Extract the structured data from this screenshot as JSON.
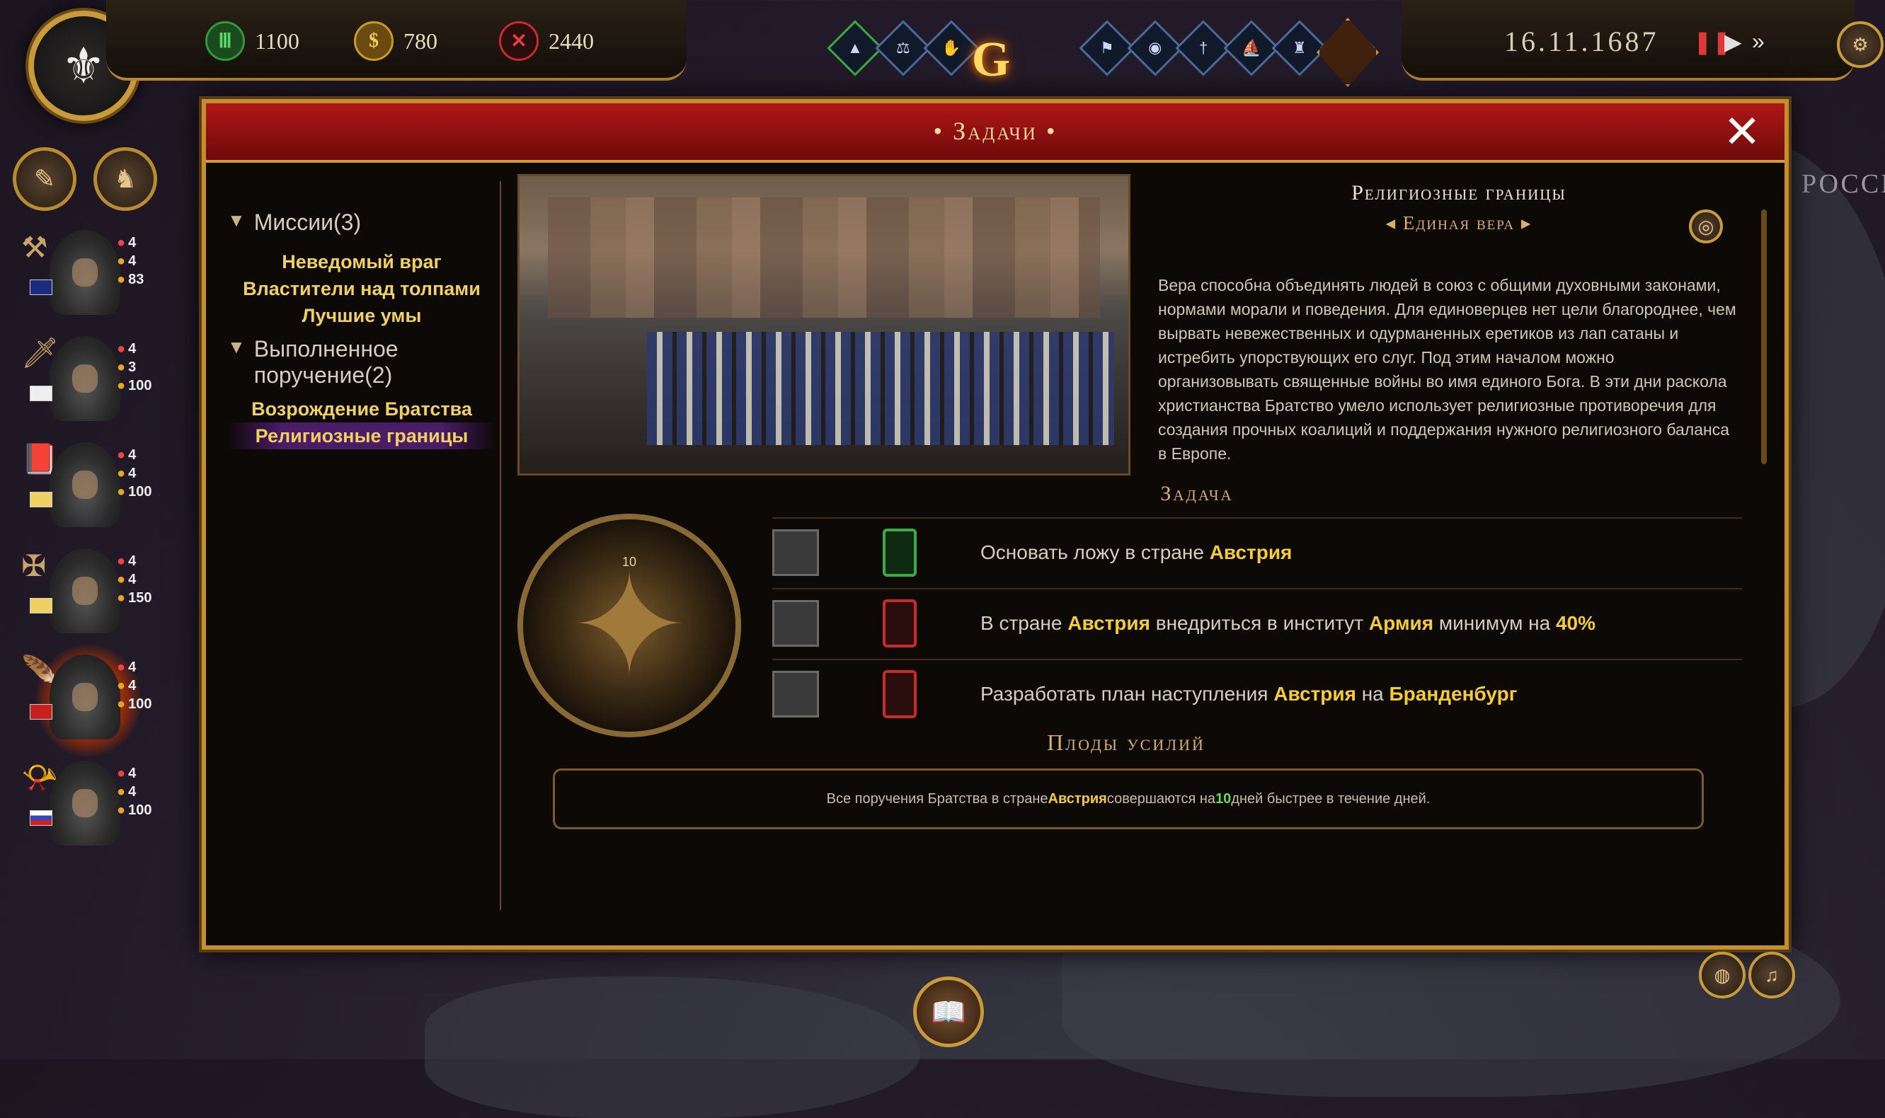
{
  "resources": [
    {
      "name": "gold-coin-green",
      "value": "1100",
      "color": "#2e9a3c",
      "icon": "coin-icon"
    },
    {
      "name": "money-bag",
      "value": "780",
      "color": "#c99a2a",
      "icon": "moneybag-icon"
    },
    {
      "name": "conflict",
      "value": "2440",
      "color": "#c92a2a",
      "icon": "crossed-swords-icon"
    }
  ],
  "date": "16.11.1687",
  "crest_letter": "G",
  "panel": {
    "title": "• Задачи •",
    "close": "✕"
  },
  "missions": {
    "category_active": "Миссии(3)",
    "active": [
      "Неведомый враг",
      "Властители над толпами",
      "Лучшие умы"
    ],
    "category_done": "Выполненное поручение(2)",
    "done": [
      "Возрождение Братства",
      "Религиозные границы"
    ]
  },
  "agents": [
    {
      "stats": [
        "4",
        "4",
        "83"
      ]
    },
    {
      "stats": [
        "4",
        "3",
        "100"
      ]
    },
    {
      "stats": [
        "4",
        "4",
        "100"
      ]
    },
    {
      "stats": [
        "4",
        "4",
        "150"
      ]
    },
    {
      "stats": [
        "4",
        "4",
        "100"
      ]
    },
    {
      "stats": [
        "4",
        "4",
        "100"
      ]
    }
  ],
  "detail": {
    "title": "Религиозные границы",
    "subtitle": "Единая вера",
    "description": "Вера способна объединять людей в союз с общими духовными законами, нормами морали и поведения. Для единоверцев нет цели благороднее, чем вырвать невежественных и одурманенных еретиков из лап сатаны и истребить упорствующих его слуг. Под этим началом можно организовывать священные войны во имя единого Бога. В эти дни раскола христианства Братство умело использует религиозные противоречия для создания прочных коалиций и поддержания нужного религиозного баланса в Европе."
  },
  "task_section": "Задача",
  "compass_number": "10",
  "tasks": [
    {
      "parts": [
        {
          "t": "Основать ложу в стране ",
          "h": false
        },
        {
          "t": "Австрия",
          "h": true
        }
      ],
      "lock_color": "#3ea844"
    },
    {
      "parts": [
        {
          "t": "В стране ",
          "h": false
        },
        {
          "t": "Австрия",
          "h": true
        },
        {
          "t": " внедриться в институт ",
          "h": false
        },
        {
          "t": "Армия",
          "h": true
        },
        {
          "t": " минимум на ",
          "h": false
        },
        {
          "t": "40%",
          "h": true
        }
      ],
      "lock_color": "#c92a2a"
    },
    {
      "parts": [
        {
          "t": "Разработать план наступления ",
          "h": false
        },
        {
          "t": "Австрия",
          "h": true
        },
        {
          "t": " на ",
          "h": false
        },
        {
          "t": "Бранденбург",
          "h": true
        }
      ],
      "lock_color": "#c92a2a"
    }
  ],
  "fruits": {
    "title": "Плоды усилий",
    "pre": "Все поручения Братства в стране ",
    "country": "Австрия",
    "mid": " совершаются на ",
    "days": "10",
    "post": " дней быстрее в течение  дней."
  },
  "map_label": "РОССИ"
}
